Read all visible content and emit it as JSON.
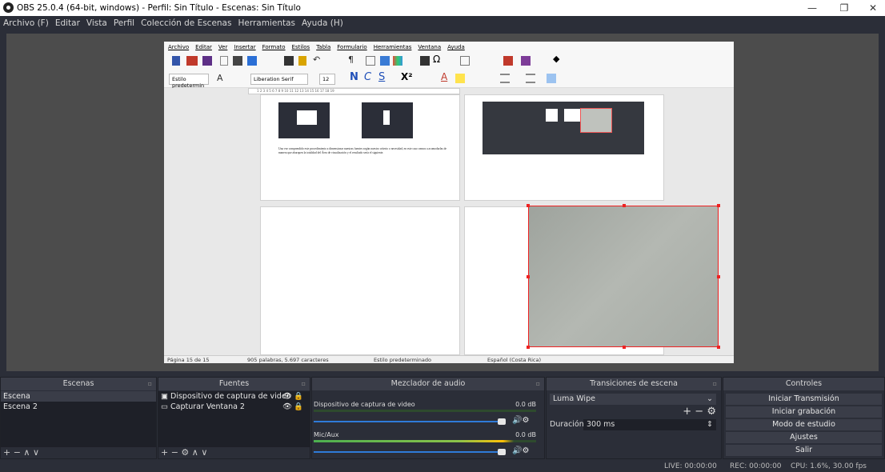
{
  "window": {
    "title": "OBS 25.0.4 (64-bit, windows) - Perfil: Sin Título - Escenas: Sin Título",
    "minimize_icon": "minimize-icon",
    "maximize_icon": "maximize-icon",
    "close_icon": "close-icon"
  },
  "menu": [
    "Archivo (F)",
    "Editar",
    "Vista",
    "Perfil",
    "Colección de Escenas",
    "Herramientas",
    "Ayuda (H)"
  ],
  "writer": {
    "menu": [
      "Archivo",
      "Editar",
      "Ver",
      "Insertar",
      "Formato",
      "Estilos",
      "Tabla",
      "Formulario",
      "Herramientas",
      "Ventana",
      "Ayuda"
    ],
    "style_combo": "Estilo predetermin",
    "font_combo": "Liberation Serif",
    "size_combo": "12",
    "ruler": "1 2 3 4 5 6 7 8 9 10 11 12 13 14 15 16 17 18 19",
    "page_text": "Una vez comprendido este procedimiento a dimensionar nuestras fuentes según nuestro criterio o necesidad, en este caso vamos a acomodarlas de manera que abarquen la totalidad del Área de visualización y el resultado sería el siguiente.",
    "status": {
      "page": "Página 15 de 15",
      "words": "905 palabras, 5.697 caracteres",
      "style": "Estilo predeterminado",
      "lang": "Español (Costa Rica)"
    }
  },
  "scenes": {
    "header": "Escenas",
    "items": [
      "Escena",
      "Escena 2"
    ],
    "selected": 0,
    "footer": "+ −  ∧ ∨"
  },
  "sources": {
    "header": "Fuentes",
    "items": [
      {
        "label": "Dispositivo de captura de video",
        "icon": "camera-icon"
      },
      {
        "label": "Capturar Ventana 2",
        "icon": "window-icon"
      }
    ],
    "footer": "+ − ⚙  ∧ ∨"
  },
  "mixer": {
    "header": "Mezclador de audio",
    "channels": [
      {
        "name": "Dispositivo de captura de video",
        "db": "0.0 dB",
        "volume": 1.0
      },
      {
        "name": "Mic/Aux",
        "db": "0.0 dB",
        "volume": 1.0
      }
    ]
  },
  "transitions": {
    "header": "Transiciones de escena",
    "selected": "Luma Wipe",
    "duration_label": "Duración",
    "duration_value": "300 ms",
    "buttons": "+ − ⚙"
  },
  "controls": {
    "header": "Controles",
    "buttons": [
      "Iniciar Transmisión",
      "Iniciar grabación",
      "Modo de estudio",
      "Ajustes",
      "Salir"
    ]
  },
  "status": {
    "live": "LIVE: 00:00:00",
    "rec": "REC: 00:00:00",
    "cpu": "CPU: 1.6%, 30.00 fps"
  }
}
